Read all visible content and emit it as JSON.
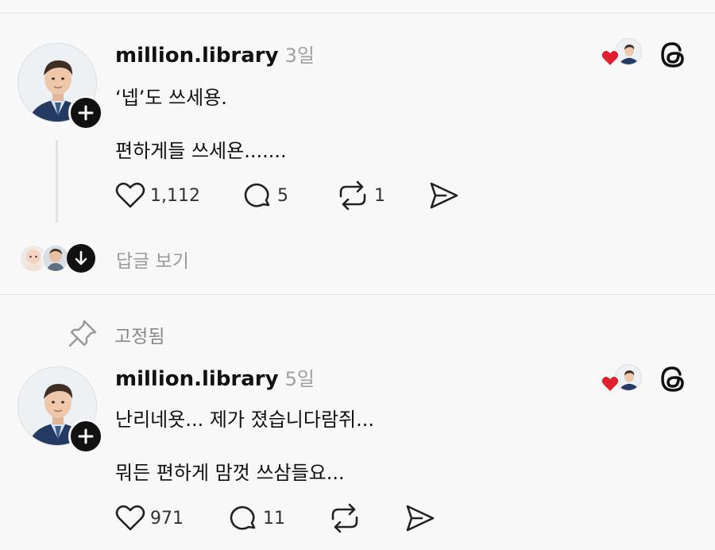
{
  "posts": [
    {
      "username": "million.library",
      "time": "3일",
      "line1": "‘넵’도 쓰세용.",
      "line2": "편하게들 쓰세욘.......",
      "likes": "1,112",
      "comments": "5",
      "reposts": "1"
    },
    {
      "pinned_label": "고정됨",
      "username": "million.library",
      "time": "5일",
      "line1": "난리네욧... 제가 졌습니다람쥐...",
      "line2": "뭐든 편하게 맘껏 쓰삼들요...",
      "likes": "971",
      "comments": "11",
      "reposts": ""
    }
  ],
  "replies": {
    "label": "답글 보기"
  },
  "colors": {
    "heart": "#e0202f",
    "text": "#111111",
    "muted": "#9a9a9a",
    "divider": "#e3e3e3"
  },
  "icons": [
    "heart-icon",
    "comment-icon",
    "repost-icon",
    "share-icon",
    "threads-logo-icon",
    "pin-icon",
    "plus-icon",
    "arrow-down-icon"
  ]
}
